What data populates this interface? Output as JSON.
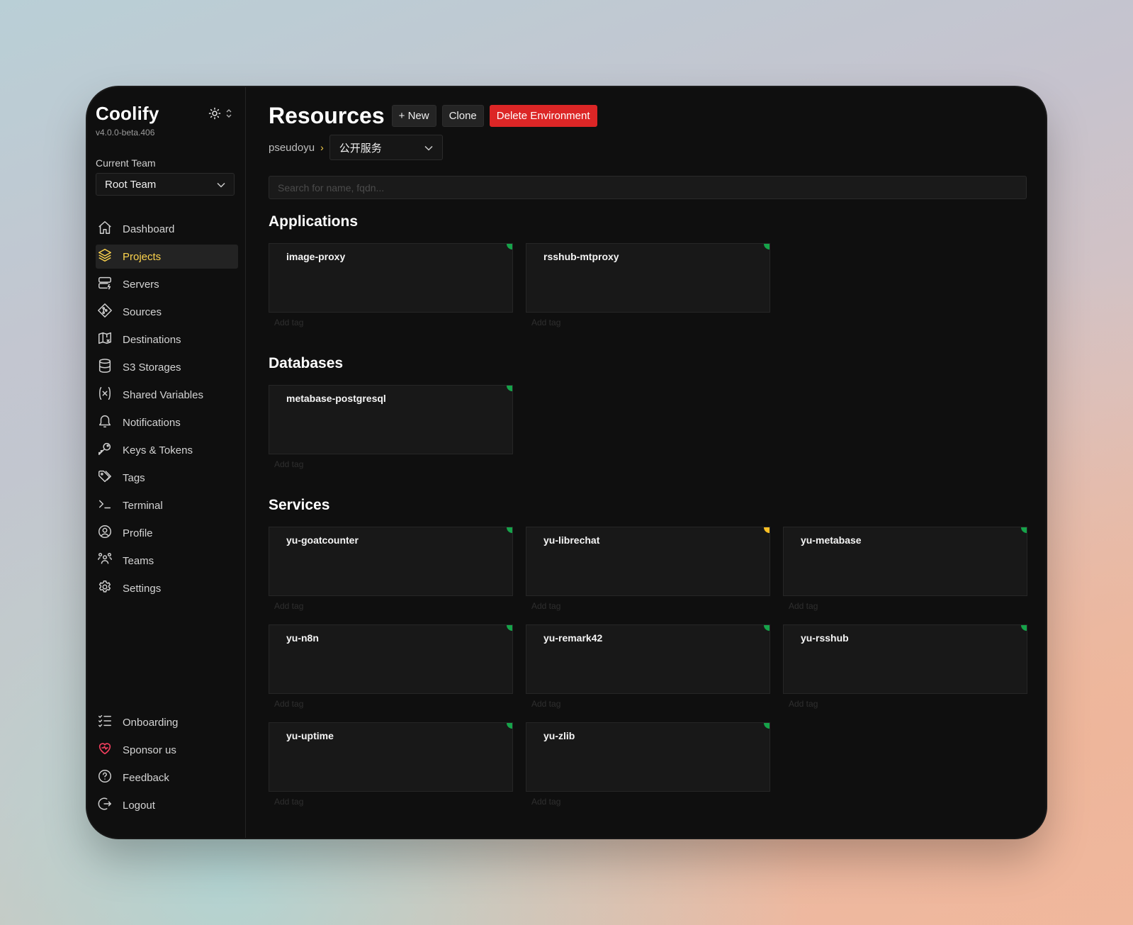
{
  "app": {
    "name": "Coolify",
    "version": "v4.0.0-beta.406"
  },
  "team": {
    "label": "Current Team",
    "selected": "Root Team"
  },
  "nav": {
    "items": [
      {
        "id": "dashboard",
        "label": "Dashboard",
        "icon": "home-icon"
      },
      {
        "id": "projects",
        "label": "Projects",
        "icon": "layers-icon",
        "active": true
      },
      {
        "id": "servers",
        "label": "Servers",
        "icon": "server-icon"
      },
      {
        "id": "sources",
        "label": "Sources",
        "icon": "git-icon"
      },
      {
        "id": "destinations",
        "label": "Destinations",
        "icon": "map-icon"
      },
      {
        "id": "s3-storages",
        "label": "S3 Storages",
        "icon": "database-icon"
      },
      {
        "id": "shared-variables",
        "label": "Shared Variables",
        "icon": "variable-icon"
      },
      {
        "id": "notifications",
        "label": "Notifications",
        "icon": "bell-icon"
      },
      {
        "id": "keys-tokens",
        "label": "Keys & Tokens",
        "icon": "key-icon"
      },
      {
        "id": "tags",
        "label": "Tags",
        "icon": "tag-icon"
      },
      {
        "id": "terminal",
        "label": "Terminal",
        "icon": "terminal-icon"
      },
      {
        "id": "profile",
        "label": "Profile",
        "icon": "user-circle-icon"
      },
      {
        "id": "teams",
        "label": "Teams",
        "icon": "users-icon"
      },
      {
        "id": "settings",
        "label": "Settings",
        "icon": "gear-icon"
      }
    ],
    "bottom": [
      {
        "id": "onboarding",
        "label": "Onboarding",
        "icon": "checklist-icon"
      },
      {
        "id": "sponsor",
        "label": "Sponsor us",
        "icon": "heart-icon"
      },
      {
        "id": "feedback",
        "label": "Feedback",
        "icon": "help-icon"
      },
      {
        "id": "logout",
        "label": "Logout",
        "icon": "logout-icon"
      }
    ]
  },
  "header": {
    "title": "Resources",
    "new_label": "+ New",
    "clone_label": "Clone",
    "delete_label": "Delete Environment"
  },
  "breadcrumb": {
    "project": "pseudoyu",
    "separator": "›",
    "environment": "公开服务"
  },
  "search": {
    "placeholder": "Search for name, fqdn...",
    "value": ""
  },
  "add_tag_label": "Add tag",
  "sections": [
    {
      "title": "Applications",
      "resources": [
        {
          "name": "image-proxy",
          "status": "running"
        },
        {
          "name": "rsshub-mtproxy",
          "status": "running"
        }
      ]
    },
    {
      "title": "Databases",
      "resources": [
        {
          "name": "metabase-postgresql",
          "status": "running"
        }
      ]
    },
    {
      "title": "Services",
      "resources": [
        {
          "name": "yu-goatcounter",
          "status": "running"
        },
        {
          "name": "yu-librechat",
          "status": "warning"
        },
        {
          "name": "yu-metabase",
          "status": "running"
        },
        {
          "name": "yu-n8n",
          "status": "running"
        },
        {
          "name": "yu-remark42",
          "status": "running"
        },
        {
          "name": "yu-rsshub",
          "status": "running"
        },
        {
          "name": "yu-uptime",
          "status": "running"
        },
        {
          "name": "yu-zlib",
          "status": "running"
        }
      ]
    }
  ],
  "colors": {
    "accent": "#fcd34d",
    "danger": "#dc2626",
    "status_running": "#16a34a",
    "status_warning": "#fbbf24",
    "sponsor_heart": "#f43f5e"
  }
}
